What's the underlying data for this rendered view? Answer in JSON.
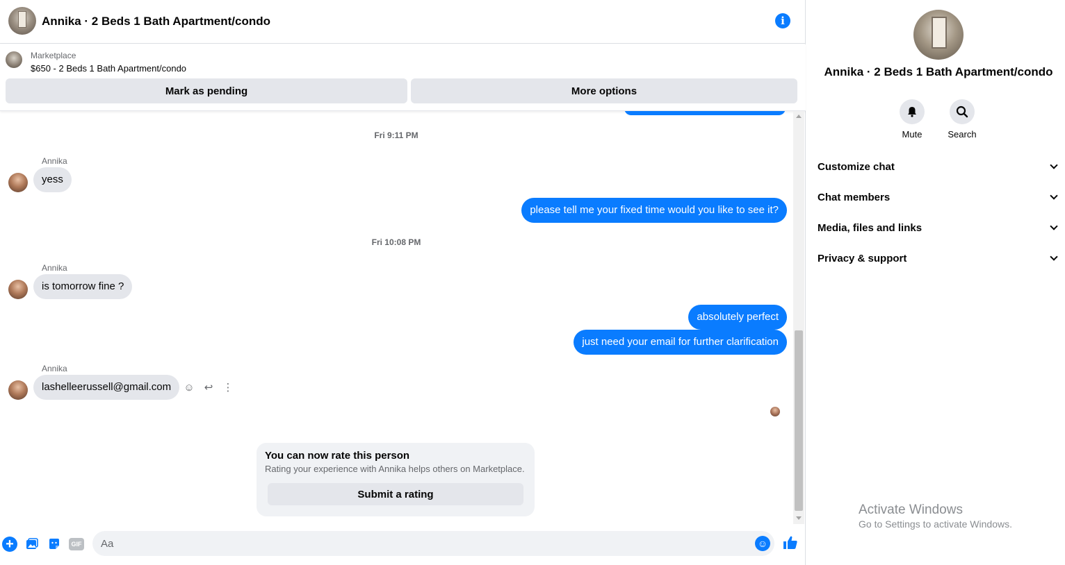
{
  "header": {
    "title": "Annika · 2 Beds 1 Bath Apartment/condo",
    "info_icon": "info-icon"
  },
  "listing": {
    "label": "Marketplace",
    "price_title": "$650 - 2 Beds 1 Bath Apartment/condo",
    "mark_pending": "Mark as pending",
    "more_options": "More options"
  },
  "messages": {
    "ts1": "Fri 9:11 PM",
    "ts2": "Fri 10:08 PM",
    "sender": "Annika",
    "m1": "yess",
    "m2": "please tell me your fixed time would you like to see it?",
    "m3": "is tomorrow fine ?",
    "m4": "absolutely perfect",
    "m5": "just need your email for further clarification",
    "m6": "lashelleerussell@gmail.com"
  },
  "rating": {
    "title": "You can now rate this person",
    "subtitle": "Rating your experience with Annika helps others on Marketplace.",
    "button": "Submit a rating"
  },
  "composer": {
    "placeholder": "Aa",
    "gif_label": "GIF"
  },
  "panel": {
    "title": "Annika · 2 Beds 1 Bath Apartment/condo",
    "mute": "Mute",
    "search": "Search",
    "sections": [
      "Customize chat",
      "Chat members",
      "Media, files and links",
      "Privacy & support"
    ]
  },
  "watermark": {
    "title": "Activate Windows",
    "subtitle": "Go to Settings to activate Windows."
  },
  "colors": {
    "accent": "#0a7cff",
    "bubble_in": "#e4e6eb",
    "muted_text": "#65676b"
  }
}
